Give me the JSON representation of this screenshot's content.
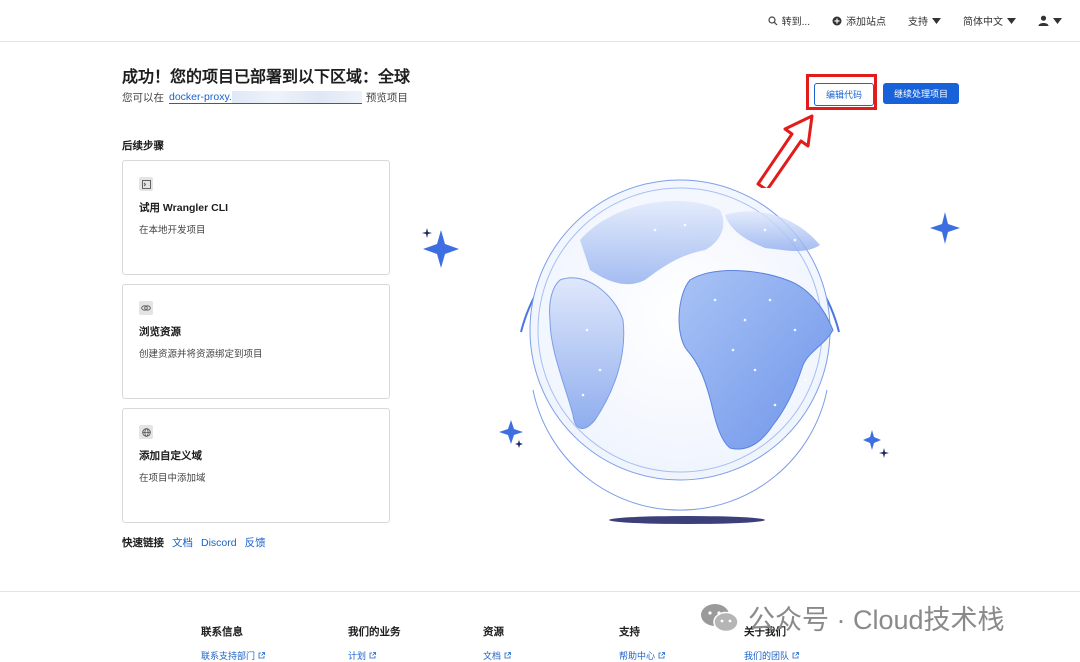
{
  "nav": {
    "goto": "转到...",
    "add_site": "添加站点",
    "support": "支持",
    "language": "简体中文"
  },
  "header": {
    "title": "成功！您的项目已部署到以下区域：全球",
    "preview_prefix": "您可以在",
    "preview_url": "docker-proxy.",
    "preview_suffix": "预览项目"
  },
  "actions": {
    "edit_code": "编辑代码",
    "continue_project": "继续处理项目"
  },
  "steps": {
    "heading": "后续步骤",
    "items": [
      {
        "title": "试用 Wrangler CLI",
        "desc": "在本地开发项目",
        "icon": "terminal-icon"
      },
      {
        "title": "浏览资源",
        "desc": "创建资源并将资源绑定到项目",
        "icon": "link-icon"
      },
      {
        "title": "添加自定义域",
        "desc": "在项目中添加域",
        "icon": "globe-icon"
      }
    ]
  },
  "quick_links": {
    "label": "快速链接",
    "links": [
      "文档",
      "Discord",
      "反馈"
    ]
  },
  "footer": {
    "columns": [
      {
        "heading": "联系信息",
        "link": "联系支持部门"
      },
      {
        "heading": "我们的业务",
        "link": "计划"
      },
      {
        "heading": "资源",
        "link": "文档"
      },
      {
        "heading": "支持",
        "link": "帮助中心"
      },
      {
        "heading": "关于我们",
        "link": "我们的团队"
      }
    ]
  },
  "watermark": {
    "text": "公众号 · Cloud技术栈"
  },
  "colors": {
    "accent": "#1762d8",
    "highlight": "#e21b1b"
  }
}
